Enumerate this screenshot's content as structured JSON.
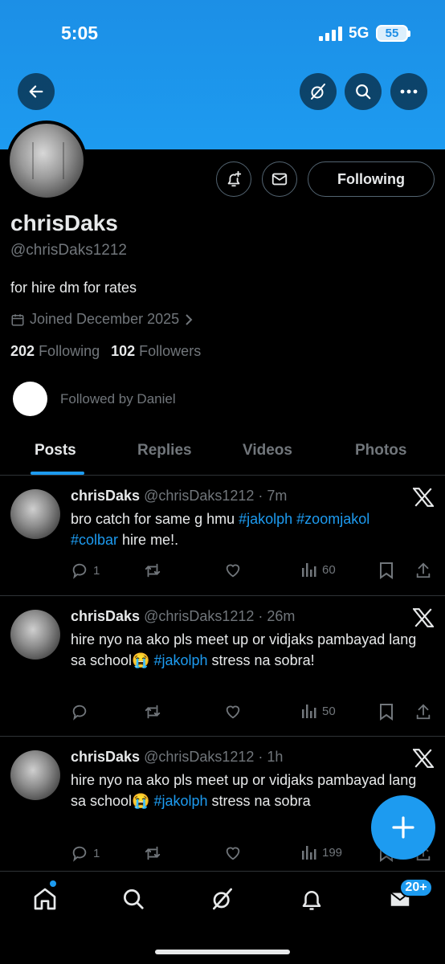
{
  "status_bar": {
    "time": "5:05",
    "network": "5G",
    "battery": "55"
  },
  "profile": {
    "name": "chrisDaks",
    "handle": "@chrisDaks1212",
    "bio": "for hire dm for rates",
    "joined": "Joined December 2025",
    "following_count": "202",
    "following_label": "Following",
    "followers_count": "102",
    "followers_label": "Followers",
    "followed_by": "Followed by Daniel",
    "follow_button": "Following"
  },
  "tabs": [
    "Posts",
    "Replies",
    "Videos",
    "Photos"
  ],
  "posts": [
    {
      "name": "chrisDaks",
      "handle_time": "@chrisDaks1212 · 7m",
      "text_parts": [
        "bro catch for same g hmu ",
        "#jakolph",
        " ",
        "#zoomjakol",
        " ",
        "#colbar",
        " hire me!."
      ],
      "replies": "1",
      "retweets": "",
      "likes": "",
      "views": "60"
    },
    {
      "name": "chrisDaks",
      "handle_time": "@chrisDaks1212 · 26m",
      "text_parts": [
        "hire nyo na ako pls meet up or vidjaks pambayad lang sa school😭 ",
        "#jakolph",
        " stress na sobra!"
      ],
      "replies": "",
      "retweets": "",
      "likes": "",
      "views": "50"
    },
    {
      "name": "chrisDaks",
      "handle_time": "@chrisDaks1212 · 1h",
      "text_parts": [
        "hire nyo na ako pls meet up or vidjaks pambayad lang sa school😭 ",
        "#jakolph",
        " stress na sobra"
      ],
      "replies": "1",
      "retweets": "",
      "likes": "",
      "views": "199"
    }
  ],
  "nav": {
    "badge": "20+"
  },
  "colors": {
    "accent": "#1d9bf0",
    "muted": "#71767b",
    "text": "#e7e9ea",
    "border": "#2f3336"
  }
}
